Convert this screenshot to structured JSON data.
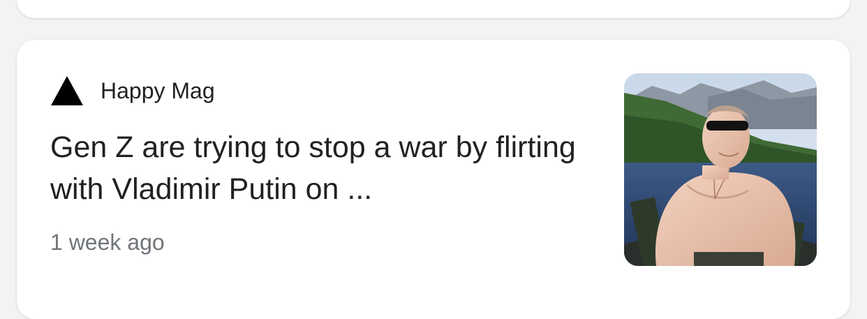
{
  "article": {
    "source": "Happy Mag",
    "headline": "Gen Z are trying to stop a war by flirting with Vladimir Putin on ...",
    "time": "1 week ago",
    "logo_icon": "black-triangle-icon",
    "thumbnail_icon": "article-photo-thumbnail"
  },
  "colors": {
    "page_bg": "#f1f3f4",
    "card_bg": "#ffffff",
    "headline_text": "#202124",
    "meta_text": "#70757a"
  }
}
